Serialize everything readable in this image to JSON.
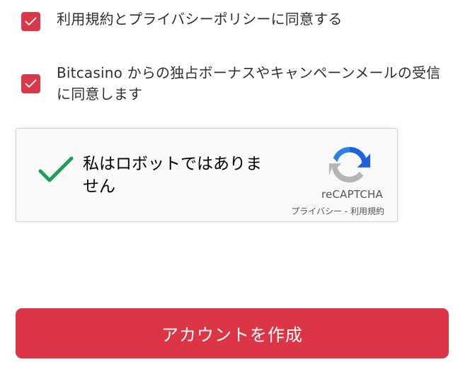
{
  "consents": [
    {
      "checked": true,
      "label": "利用規約とプライバシーポリシーに同意する"
    },
    {
      "checked": true,
      "label": "Bitcasino からの独占ボーナスやキャンペーンメールの受信に同意します"
    }
  ],
  "captcha": {
    "checked": true,
    "label": "私はロボットではありません",
    "brand": "reCAPTCHA",
    "privacy_link": "プライバシー",
    "separator": " - ",
    "terms_link": "利用規約"
  },
  "submit": {
    "label": "アカウントを作成"
  },
  "colors": {
    "accent": "#dc3545",
    "check_green": "#1e9e5a",
    "captcha_bg": "#f9f9f9"
  }
}
